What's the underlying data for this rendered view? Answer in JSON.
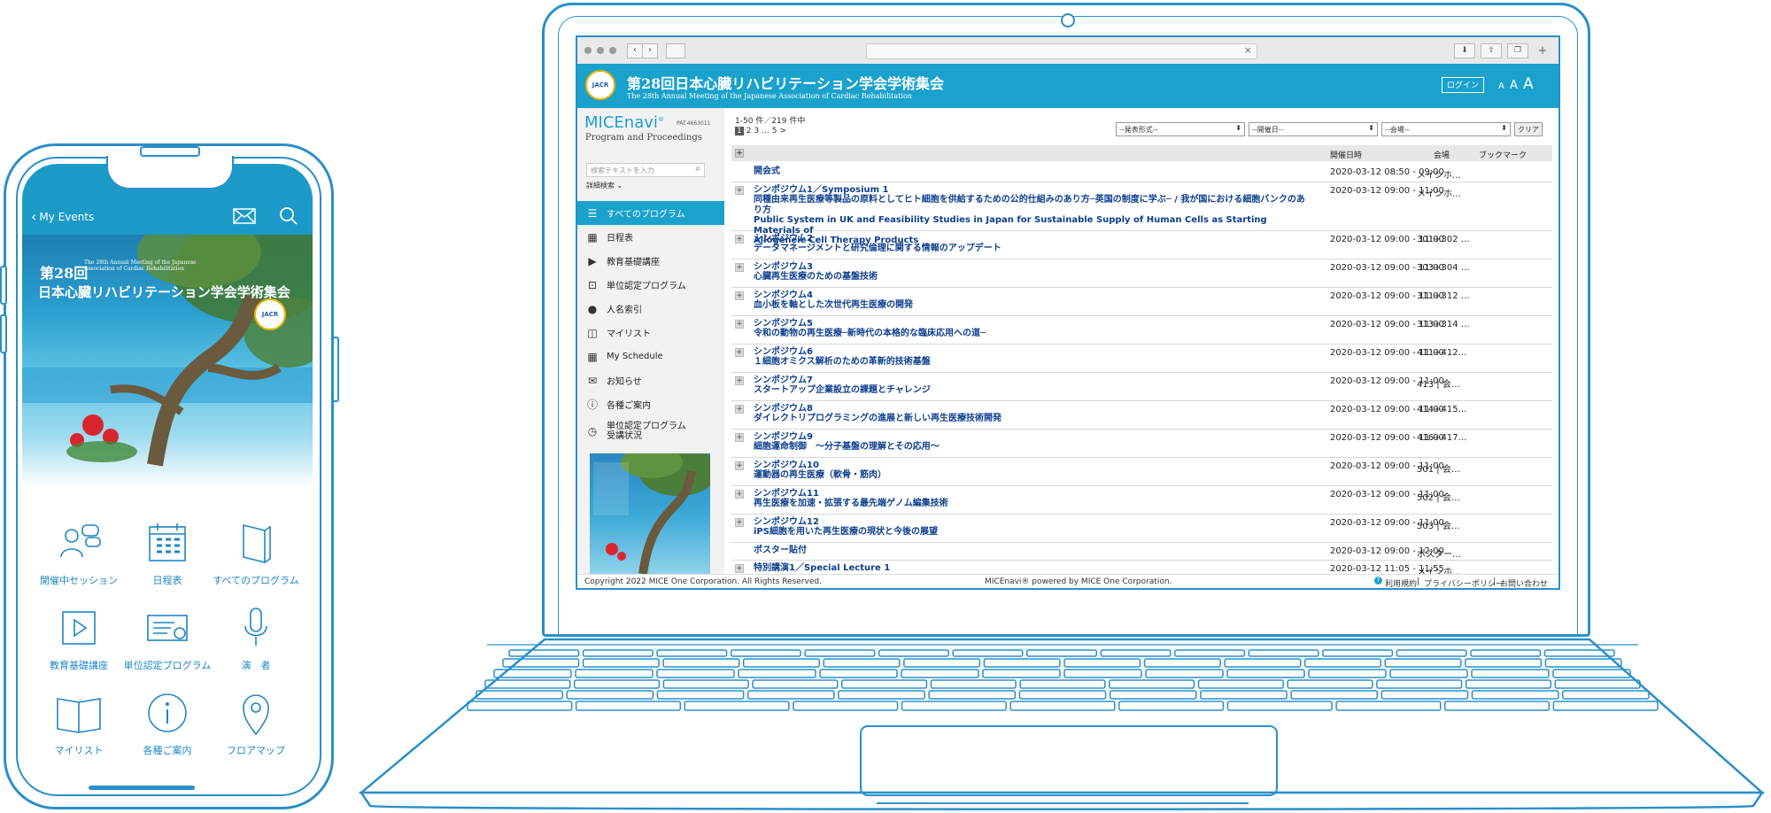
{
  "phone": {
    "back_label": "My Events",
    "hero": {
      "edition": "第28回",
      "english": "The 28th Annual Meeting of the Japanese Association of Cardiac Rehabilitation",
      "title": "日本心臓リハビリテーション学会学術集会",
      "badge": "JACR"
    },
    "tiles": [
      {
        "label": "開催中セッション",
        "icon": "people-chat-icon"
      },
      {
        "label": "日程表",
        "icon": "calendar-icon"
      },
      {
        "label": "すべてのプログラム",
        "icon": "book-icon"
      },
      {
        "label": "教育基礎講座",
        "icon": "play-icon"
      },
      {
        "label": "単位認定プログラム",
        "icon": "certificate-icon"
      },
      {
        "label": "演　者",
        "icon": "microphone-icon"
      },
      {
        "label": "マイリスト",
        "icon": "open-book-icon"
      },
      {
        "label": "各種ご案内",
        "icon": "info-icon"
      },
      {
        "label": "フロアマップ",
        "icon": "map-pin-icon"
      }
    ]
  },
  "browser": {
    "site_title": "第28回日本心臓リハビリテーション学会学術集会",
    "site_subtitle": "The 28th Annual Meeting of the Japanese Association of Cardiac Rehabilitation",
    "site_badge": "JACR",
    "login_label": "ログイン",
    "font_sizes": [
      "A",
      "A",
      "A"
    ],
    "brand": {
      "name": "MICEnavi",
      "mark": "®",
      "patent": "PAT.4663011",
      "tagline": "Program and Proceedings"
    },
    "search": {
      "placeholder": "検索テキストを入力",
      "advanced_label": "詳細検索"
    },
    "menu": [
      {
        "label": "すべてのプログラム",
        "icon": "list-icon",
        "active": true
      },
      {
        "label": "日程表",
        "icon": "calendar-icon"
      },
      {
        "label": "教育基礎講座",
        "icon": "play-icon"
      },
      {
        "label": "単位認定プログラム",
        "icon": "certificate-icon"
      },
      {
        "label": "人名索引",
        "icon": "person-icon"
      },
      {
        "label": "マイリスト",
        "icon": "book-icon"
      },
      {
        "label": "My Schedule",
        "icon": "calendar-icon"
      },
      {
        "label": "お知らせ",
        "icon": "mail-icon"
      },
      {
        "label": "各種ご案内",
        "icon": "info-icon"
      },
      {
        "label": "単位認定プログラム\n受講状況",
        "icon": "clock-icon"
      }
    ],
    "results": {
      "count": "1-50 件／219 件中",
      "pages": [
        "1",
        "2",
        "3",
        "...",
        "5",
        ">"
      ]
    },
    "filters": [
      "--発表形式--",
      "--開催日--",
      "--会場--"
    ],
    "clear_label": "クリア",
    "columns": [
      "開催日時",
      "会場",
      "ブックマーク"
    ],
    "rows": [
      {
        "title": "開会式",
        "datetime": "2020-03-12 08:50 - 09:00",
        "room": "メインホ…",
        "plus": false
      },
      {
        "title": "シンポジウム1／Symposium 1\n同種由来再生医療等製品の原料としてヒト細胞を供給するための公的仕組みのあり方─英国の制度に学ぶ─ / 我が国における細胞バンクのあり方\nPublic System in UK and Feasibility Studies in Japan for Sustainable Supply of Human Cells as Starting Materials of\nAllogeneic Cell Therapy Products",
        "datetime": "2020-03-12 09:00 - 11:00",
        "room": "メインホ…",
        "plus": true
      },
      {
        "title": "シンポジウム2\nデータマネージメントと研究倫理に関する情報のアップデート",
        "datetime": "2020-03-12 09:00 - 11:00",
        "room": "301+302 …",
        "plus": true
      },
      {
        "title": "シンポジウム3\n心臓再生医療のための基盤技術",
        "datetime": "2020-03-12 09:00 - 11:00",
        "room": "303+304 …",
        "plus": true
      },
      {
        "title": "シンポジウム4\n血小板を軸とした次世代再生医療の開発",
        "datetime": "2020-03-12 09:00 - 11:00",
        "room": "311+312 …",
        "plus": true
      },
      {
        "title": "シンポジウム5\n令和の動物の再生医療─新時代の本格的な臨床応用への道─",
        "datetime": "2020-03-12 09:00 - 11:00",
        "room": "313+314 …",
        "plus": true
      },
      {
        "title": "シンポジウム6\n１細胞オミクス解析のための革新的技術基盤",
        "datetime": "2020-03-12 09:00 - 11:00",
        "room": "411+412…",
        "plus": true
      },
      {
        "title": "シンポジウム7\nスタートアップ企業設立の課題とチャレンジ",
        "datetime": "2020-03-12 09:00 - 11:00",
        "room": "413 | 会…",
        "plus": true
      },
      {
        "title": "シンポジウム8\nダイレクトリプログラミングの進展と新しい再生医療技術開発",
        "datetime": "2020-03-12 09:00 - 11:00",
        "room": "414+415…",
        "plus": true
      },
      {
        "title": "シンポジウム9\n細胞運命制御　～分子基盤の理解とその応用～",
        "datetime": "2020-03-12 09:00 - 11:00",
        "room": "416+417…",
        "plus": true
      },
      {
        "title": "シンポジウム10\n運動器の再生医療（軟骨・筋肉）",
        "datetime": "2020-03-12 09:00 - 11:00",
        "room": "501 | 会…",
        "plus": true
      },
      {
        "title": "シンポジウム11\n再生医療を加速・拡張する最先端ゲノム編集技術",
        "datetime": "2020-03-12 09:00 - 11:00",
        "room": "502 | 会…",
        "plus": true
      },
      {
        "title": "シンポジウム12\niPS細胞を用いた再生医療の現状と今後の展望",
        "datetime": "2020-03-12 09:00 - 11:00",
        "room": "503 | 会…",
        "plus": true
      },
      {
        "title": "ポスター貼付",
        "datetime": "2020-03-12 09:00 - 12:00",
        "room": "ポスター…",
        "plus": false
      },
      {
        "title": "特別講演1／Special Lecture 1",
        "datetime": "2020-03-12 11:05 - 11:55",
        "room": "メインホ…",
        "plus": true
      }
    ],
    "footer": {
      "copyright": "Copyright 2022 MICE One Corporation. All Rights Reserved.",
      "powered": "MICEnavi® powered by MICE One Corporation.",
      "links": [
        "利用規約",
        "プライバシーポリシー",
        "お問い合わせ"
      ]
    }
  },
  "colors": {
    "accent": "#1aa2cc",
    "outline": "#2a8fc9",
    "link": "#0e3f8f"
  }
}
